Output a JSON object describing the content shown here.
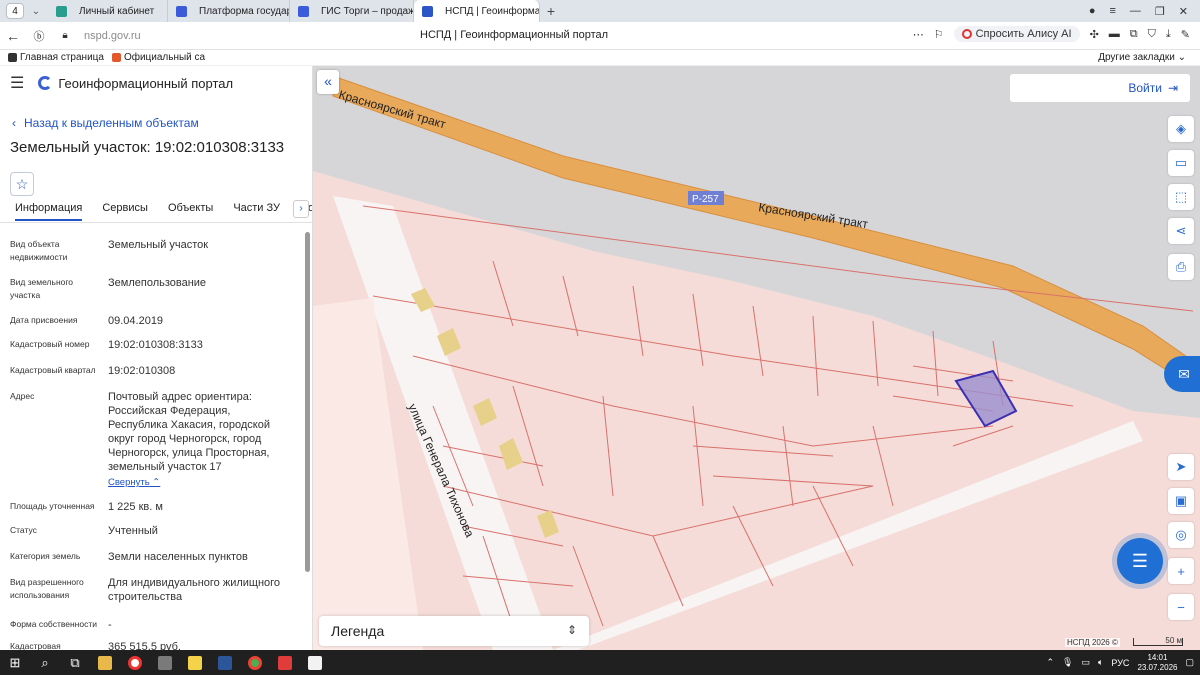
{
  "browser": {
    "tab_count": "4",
    "tabs": [
      {
        "title": "Личный кабинет",
        "color": "#2a9d8f"
      },
      {
        "title": "Платформа государстве",
        "color": "#3b5bdb"
      },
      {
        "title": "ГИС Торги – продажи гос",
        "color": "#3b5bdb"
      },
      {
        "title": "НСПД | Геоинформаци",
        "color": "#2c55c6"
      }
    ],
    "url": "nspd.gov.ru",
    "page_title": "НСПД | Геоинформационный портал",
    "alice": "Спросить Алису AI",
    "bookmarks": [
      "Главная страница",
      "Официальный са"
    ],
    "other_bookmarks": "Другие закладки"
  },
  "sidebar": {
    "portal_name": "Геоинформационный портал",
    "back_link": "Назад к выделенным объектам",
    "object_title": "Земельный участок: 19:02:010308:3133",
    "tabs": [
      "Информация",
      "Сервисы",
      "Объекты",
      "Части ЗУ",
      "Состав"
    ],
    "fields": [
      {
        "label": "Вид объекта недвижимости",
        "value": "Земельный участок"
      },
      {
        "label": "Вид земельного участка",
        "value": "Землепользование"
      },
      {
        "label": "Дата присвоения",
        "value": "09.04.2019"
      },
      {
        "label": "Кадастровый номер",
        "value": "19:02:010308:3133"
      },
      {
        "label": "Кадастровый квартал",
        "value": "19:02:010308"
      },
      {
        "label": "Адрес",
        "value": "Почтовый адрес ориентира: Российская Федерация, Республика Хакасия, городской округ город Черногорск, город Черногорск, улица Просторная, земельный участок 17"
      },
      {
        "label": "Площадь уточненная",
        "value": "1 225 кв. м"
      },
      {
        "label": "Статус",
        "value": "Учтенный"
      },
      {
        "label": "Категория земель",
        "value": "Земли населенных пунктов"
      },
      {
        "label": "Вид разрешенного использования",
        "value": "Для индивидуального жилищного строительства"
      },
      {
        "label": "Форма собственности",
        "value": "-"
      },
      {
        "label": "Кадастровая стоимость",
        "value": "365 515,5 руб."
      }
    ],
    "collapse_link": "Свернуть"
  },
  "map": {
    "road_name_1": "Красноярский тракт",
    "road_name_2": "Красноярский тракт",
    "road_badge": "Р-257",
    "street_name": "улица Генерала Тихонова",
    "login": "Войти",
    "legend": "Легенда",
    "copyright": "НСПД 2026 ©",
    "scale": "50 м",
    "colors": {
      "parcel_bg": "#f5dcd8",
      "road": "#e8a95a",
      "highlight": "#9b8fd0",
      "accent": "#2154c4"
    }
  },
  "taskbar": {
    "lang": "РУС",
    "time": "14:01",
    "date": "23.07.2026"
  }
}
